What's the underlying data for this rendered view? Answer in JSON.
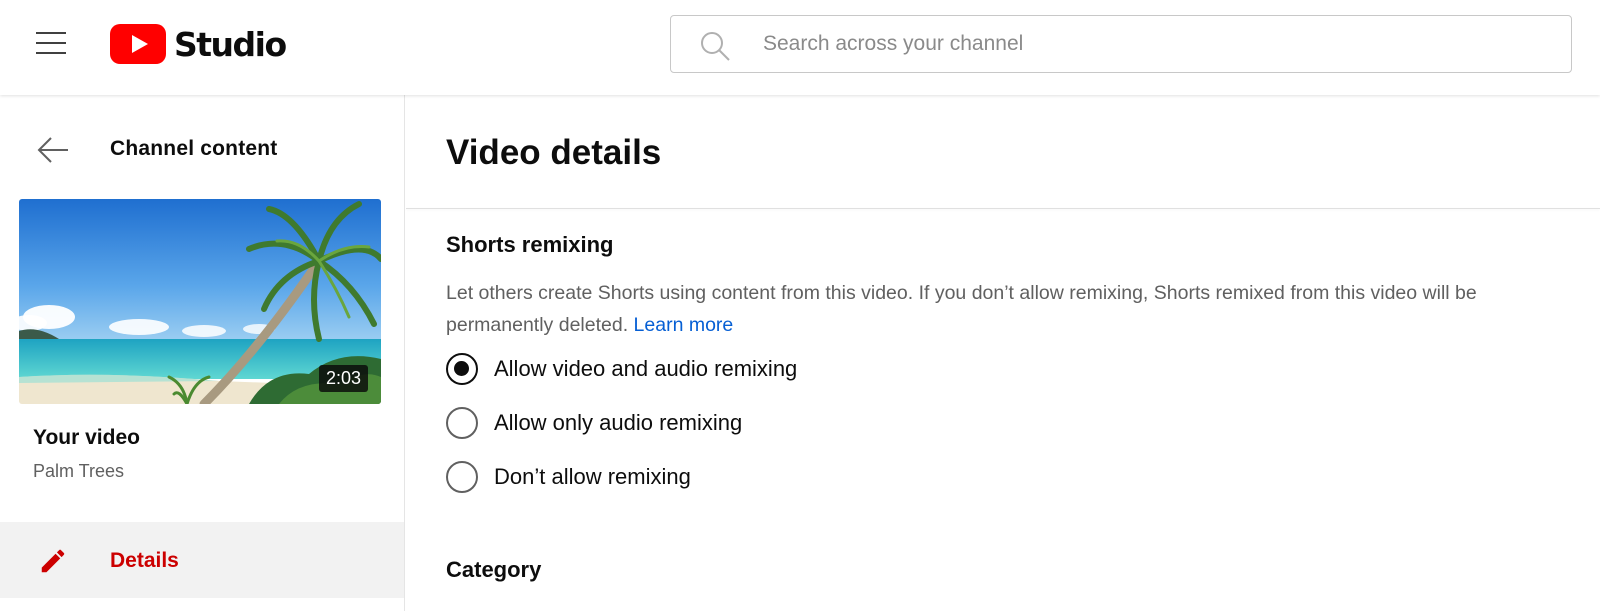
{
  "header": {
    "app_name": "Studio",
    "search": {
      "placeholder": "Search across your channel",
      "value": ""
    },
    "icons": {
      "menu": "hamburger-menu-icon",
      "logo": "youtube-play-logo",
      "search": "search-icon"
    },
    "colors": {
      "brand_red": "#ff0000"
    }
  },
  "sidebar": {
    "back_label": "Channel content",
    "video": {
      "duration": "2:03",
      "section_label": "Your video",
      "name": "Palm Trees"
    },
    "nav": [
      {
        "label": "Details",
        "icon": "pencil-icon",
        "active": true,
        "color": "#cc0000"
      }
    ]
  },
  "main": {
    "title": "Video details",
    "shorts_remixing": {
      "title": "Shorts remixing",
      "description": "Let others create Shorts using content from this video. If you don’t allow remixing, Shorts remixed from this video will be permanently deleted.",
      "learn_more": "Learn more",
      "options": [
        {
          "label": "Allow video and audio remixing",
          "selected": true
        },
        {
          "label": "Allow only audio remixing",
          "selected": false
        },
        {
          "label": "Don’t allow remixing",
          "selected": false
        }
      ]
    },
    "category": {
      "title": "Category"
    }
  }
}
